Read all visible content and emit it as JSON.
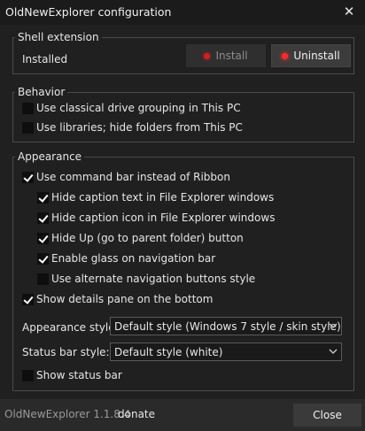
{
  "window": {
    "title": "OldNewExplorer configuration"
  },
  "shell": {
    "heading": "Shell extension",
    "status": "Installed",
    "install_label": "Install",
    "uninstall_label": "Uninstall"
  },
  "behavior": {
    "heading": "Behavior",
    "options": [
      {
        "label": "Use classical drive grouping in This PC",
        "checked": false
      },
      {
        "label": "Use libraries; hide folders from This PC",
        "checked": false
      }
    ]
  },
  "appearance": {
    "heading": "Appearance",
    "options": [
      {
        "label": "Use command bar instead of Ribbon",
        "checked": true
      },
      {
        "label": "Hide caption text in File Explorer windows",
        "checked": true
      },
      {
        "label": "Hide caption icon in File Explorer windows",
        "checked": true
      },
      {
        "label": "Hide Up (go to parent folder) button",
        "checked": true
      },
      {
        "label": "Enable glass on navigation bar",
        "checked": true
      },
      {
        "label": "Use alternate navigation buttons style",
        "checked": false
      },
      {
        "label": "Show details pane on the bottom",
        "checked": true
      },
      {
        "label": "Show status bar",
        "checked": false
      }
    ],
    "style_label": "Appearance style:",
    "style_value": "Default style (Windows 7 style / skin style)",
    "statusbar_label": "Status bar style:",
    "statusbar_value": "Default style (white)"
  },
  "footer": {
    "version": "OldNewExplorer 1.1.8.4",
    "donate": "donate",
    "close_label": "Close"
  },
  "colors": {
    "background": "#202020",
    "titlebar": "#1b1b1b",
    "footer": "#2a2a2a",
    "led_red": "#ff2a2a",
    "text": "#e6e6e6"
  }
}
